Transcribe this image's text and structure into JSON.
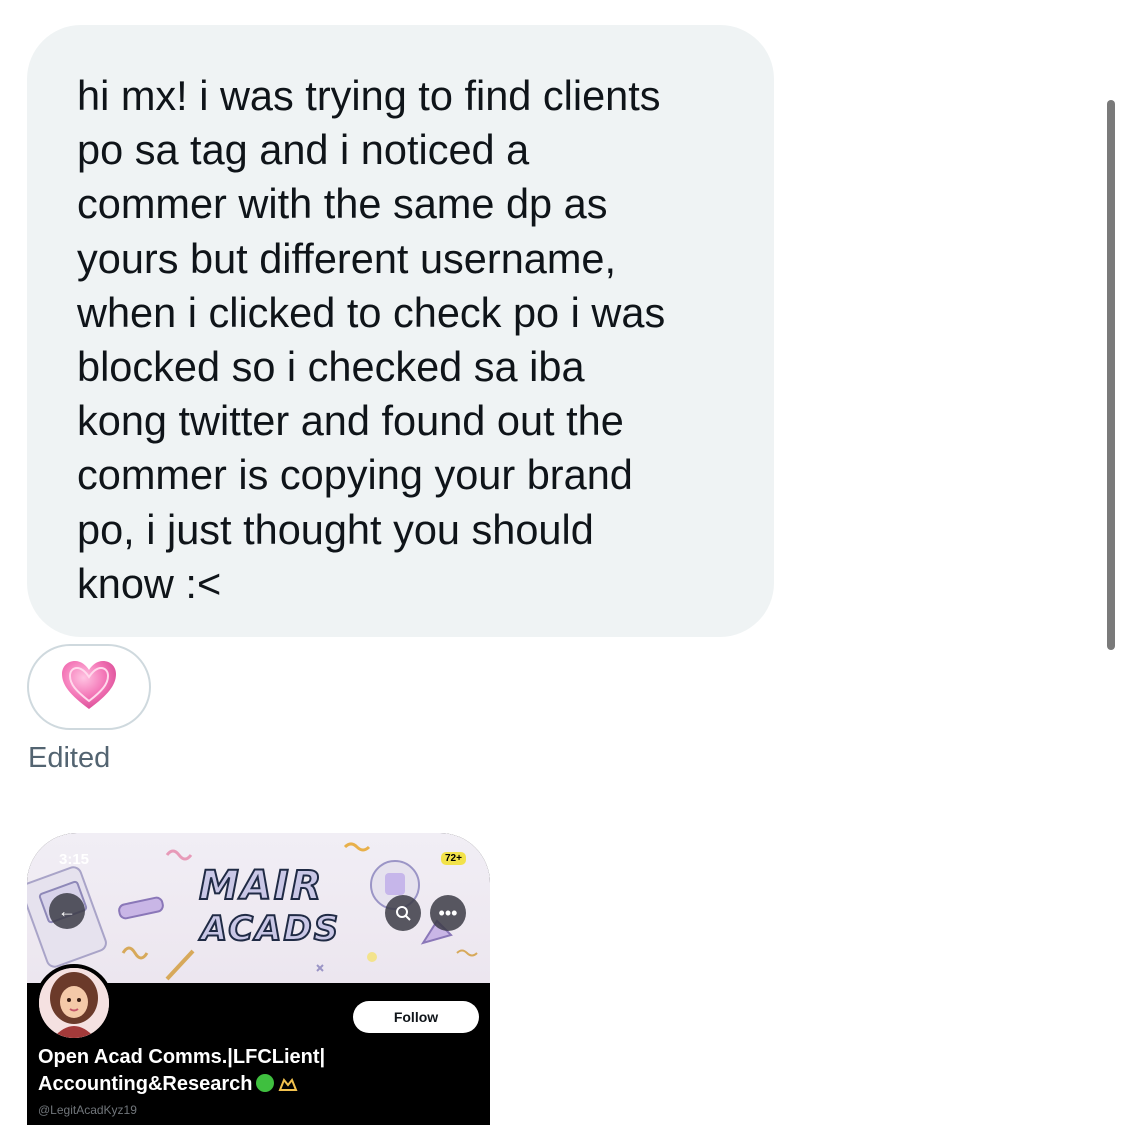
{
  "message": {
    "lines": [
      "hi mx! i was trying to find clients",
      "po sa tag and i noticed a",
      "commer with the same dp as",
      "yours but different username,",
      "when i clicked to check po i was",
      "blocked so i checked sa iba",
      "kong twitter and found out the",
      "commer is copying your brand",
      "po, i just thought you should",
      "know :<"
    ],
    "reaction_icon": "pink-heart-icon",
    "edited_label": "Edited"
  },
  "attachment": {
    "status_time": "3:15",
    "battery": "72+",
    "banner_line1": "MAIR",
    "banner_line2": "ACADS",
    "follow_label": "Follow",
    "profile_name_line1": "Open Acad Comms.|LFCLient|",
    "profile_name_line2": "Accounting&Research",
    "handle": "@LegitAcadKyz19",
    "back_icon": "back-arrow-icon",
    "search_icon": "search-icon",
    "more_icon": "more-icon"
  },
  "colors": {
    "bubble": "#eff3f4",
    "muted_text": "#536471",
    "heart": "#f06aa8"
  }
}
